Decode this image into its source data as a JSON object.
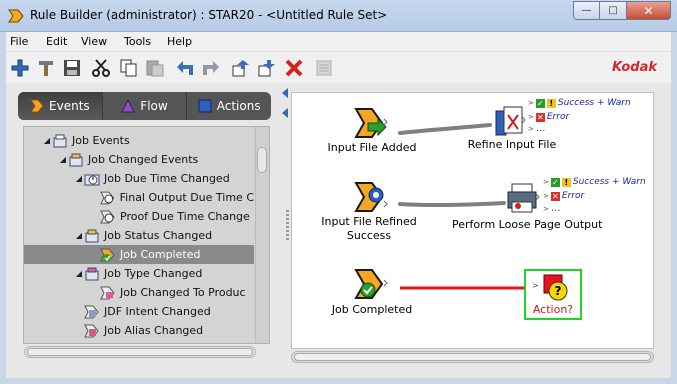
{
  "window": {
    "title": "Rule Builder (administrator) : STAR20 - <Untitled Rule Set>",
    "buttons": {
      "minimize": "—",
      "maximize": "□",
      "close": "✕"
    }
  },
  "menu": [
    "File",
    "Edit",
    "View",
    "Tools",
    "Help"
  ],
  "toolbar": {
    "brand": "Kodak",
    "icons": [
      "add-icon",
      "hammer-icon",
      "save-icon",
      "cut-icon",
      "copy-icon",
      "paste-icon",
      "undo-icon",
      "redo-icon",
      "move-up-icon",
      "move-down-icon",
      "delete-icon",
      "properties-icon"
    ]
  },
  "tabs": [
    {
      "label": "Events",
      "active": true
    },
    {
      "label": "Flow",
      "active": false
    },
    {
      "label": "Actions",
      "active": false
    }
  ],
  "tree": [
    {
      "label": "Job Events",
      "level": 0,
      "expanded": true,
      "selected": false
    },
    {
      "label": "Job Changed Events",
      "level": 1,
      "expanded": true,
      "selected": false
    },
    {
      "label": "Job Due Time Changed",
      "level": 2,
      "expanded": true,
      "selected": false
    },
    {
      "label": "Final Output Due Time C",
      "level": 3,
      "selected": false
    },
    {
      "label": "Proof Due Time Change",
      "level": 3,
      "selected": false
    },
    {
      "label": "Job Status Changed",
      "level": 2,
      "expanded": true,
      "selected": false
    },
    {
      "label": "Job Completed",
      "level": 3,
      "selected": true
    },
    {
      "label": "Job Type Changed",
      "level": 2,
      "expanded": true,
      "selected": false
    },
    {
      "label": "Job Changed To Produc",
      "level": 3,
      "selected": false
    },
    {
      "label": "JDF Intent Changed",
      "level": 2,
      "selected": false
    },
    {
      "label": "Job Alias Changed",
      "level": 2,
      "selected": false
    }
  ],
  "canvas": {
    "rows": [
      {
        "event": {
          "label": "Input File Added"
        },
        "action": {
          "label": "Refine Input File"
        },
        "outcomes": {
          "success": "Success + Warn",
          "error": "Error",
          "more": "..."
        }
      },
      {
        "event": {
          "label_line1": "Input File Refined",
          "label_line2": "Success"
        },
        "action": {
          "label": "Perform Loose Page Output"
        },
        "outcomes": {
          "success": "Success + Warn",
          "error": "Error",
          "more": "..."
        }
      },
      {
        "event": {
          "label": "Job Completed"
        },
        "action": {
          "label": "Action?"
        }
      }
    ],
    "colors": {
      "link_gray": "#808080",
      "link_red": "#e8141b",
      "selection_green": "#22d422",
      "action_text": "#d01818"
    }
  }
}
